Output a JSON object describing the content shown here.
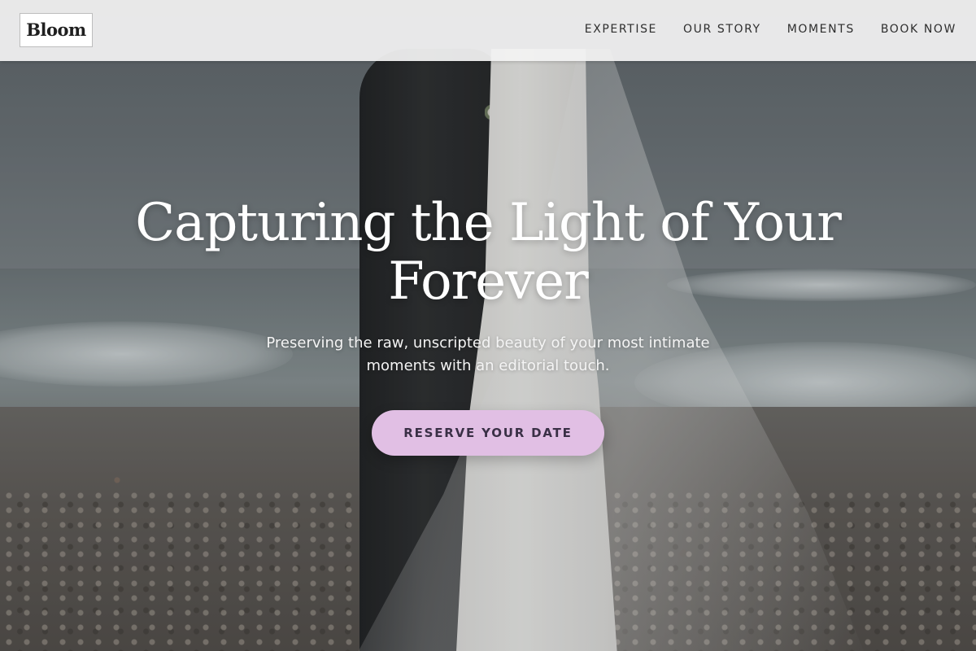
{
  "brand": {
    "logo_text": "Bloom"
  },
  "nav": {
    "items": [
      {
        "label": "EXPERTISE"
      },
      {
        "label": "OUR STORY"
      },
      {
        "label": "MOMENTS"
      },
      {
        "label": "BOOK NOW"
      }
    ]
  },
  "hero": {
    "headline": "Capturing the Light of Your Forever",
    "subheadline": "Preserving the raw, unscripted beauty of your most intimate moments with an editorial touch.",
    "cta_label": "RESERVE YOUR DATE",
    "background_image": "couple-on-beach-photo"
  },
  "colors": {
    "cta_background": "#e1bfe4",
    "cta_text": "#3a3046",
    "header_background": "#f3f3f3",
    "headline": "#ffffff"
  }
}
